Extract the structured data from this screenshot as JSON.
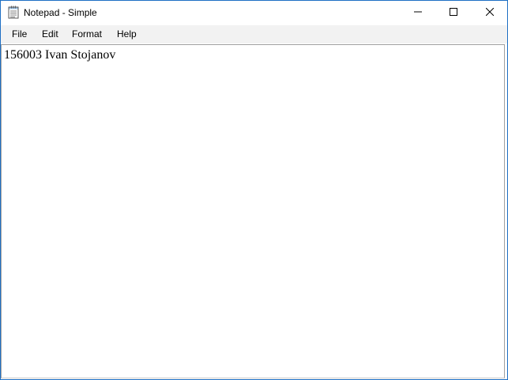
{
  "window": {
    "title": "Notepad - Simple",
    "app_icon": "notepad-icon",
    "controls": {
      "minimize_icon": "minimize-icon",
      "maximize_icon": "maximize-icon",
      "close_icon": "close-icon"
    }
  },
  "menubar": {
    "items": [
      {
        "label": "File"
      },
      {
        "label": "Edit"
      },
      {
        "label": "Format"
      },
      {
        "label": "Help"
      }
    ]
  },
  "editor": {
    "content": "156003 Ivan Stojanov"
  },
  "colors": {
    "window_border": "#1e6fc4",
    "menubar_bg": "#f2f2f2",
    "editor_bg": "#ffffff",
    "text": "#000000"
  }
}
